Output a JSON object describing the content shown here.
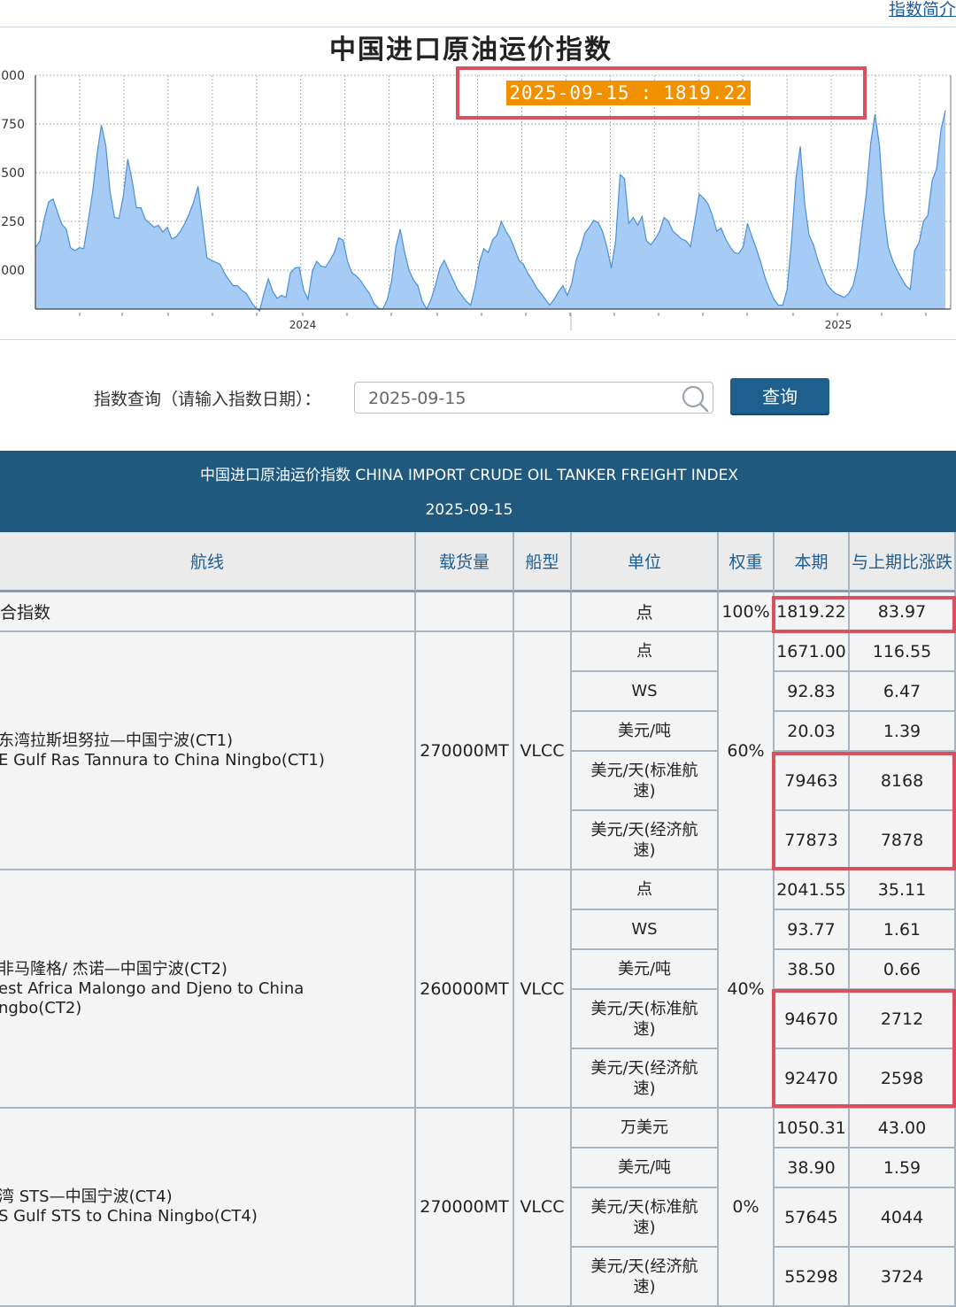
{
  "top_link": "指数简介",
  "chart": {
    "title": "中国进口原油运价指数",
    "tooltip_date": "2025-09-15",
    "tooltip_sep": ":",
    "tooltip_value": "1819.22"
  },
  "chart_data": {
    "type": "area",
    "title": "中国进口原油运价指数",
    "y_tick_labels": [
      "000",
      "750",
      "500",
      "250",
      "000"
    ],
    "x_tick_labels": [
      "2024",
      "2025"
    ],
    "grid": true,
    "fill_color": "#a6cbf5",
    "line_color": "#4a90d9",
    "series": [
      {
        "values": [
          1115,
          1150,
          1260,
          1350,
          1365,
          1300,
          1235,
          1210,
          1115,
          1100,
          1115,
          1110,
          1250,
          1400,
          1590,
          1745,
          1640,
          1400,
          1270,
          1265,
          1380,
          1570,
          1460,
          1320,
          1320,
          1260,
          1240,
          1220,
          1230,
          1195,
          1220,
          1160,
          1170,
          1200,
          1240,
          1290,
          1350,
          1430,
          1250,
          1065,
          1050,
          1040,
          1030,
          985,
          950,
          920,
          920,
          895,
          880,
          840,
          810,
          790,
          880,
          955,
          890,
          855,
          870,
          860,
          985,
          1010,
          1015,
          900,
          850,
          995,
          1045,
          1020,
          1015,
          1050,
          1090,
          1165,
          1155,
          1045,
          985,
          970,
          945,
          910,
          880,
          830,
          805,
          800,
          845,
          940,
          1120,
          1210,
          1090,
          1000,
          950,
          920,
          840,
          800,
          850,
          920,
          1010,
          1050,
          1000,
          950,
          900,
          870,
          840,
          820,
          910,
          1040,
          1110,
          1090,
          1155,
          1180,
          1250,
          1200,
          1165,
          1110,
          1050,
          1030,
          985,
          950,
          910,
          880,
          850,
          820,
          850,
          890,
          920,
          870,
          930,
          1050,
          1110,
          1190,
          1220,
          1255,
          1245,
          1200,
          1120,
          1010,
          1150,
          1490,
          1470,
          1240,
          1270,
          1230,
          1275,
          1150,
          1130,
          1160,
          1200,
          1270,
          1250,
          1200,
          1180,
          1160,
          1150,
          1120,
          1250,
          1390,
          1370,
          1340,
          1280,
          1200,
          1215,
          1160,
          1120,
          1090,
          1085,
          1120,
          1240,
          1170,
          1110,
          1040,
          960,
          900,
          850,
          820,
          820,
          900,
          1150,
          1470,
          1635,
          1340,
          1180,
          1130,
          1050,
          990,
          930,
          900,
          880,
          870,
          860,
          880,
          920,
          1020,
          1210,
          1390,
          1650,
          1800,
          1640,
          1300,
          1120,
          1050,
          1000,
          960,
          920,
          900,
          1100,
          1140,
          1250,
          1280,
          1460,
          1520,
          1720,
          1819
        ]
      }
    ]
  },
  "query": {
    "label": "指数查询（请输入指数日期）：",
    "input_value": "2025-09-15",
    "button": "查询"
  },
  "table": {
    "title": "中国进口原油运价指数 CHINA IMPORT CRUDE OIL TANKER FREIGHT INDEX",
    "date": "2025-09-15",
    "headers": {
      "route": "航线",
      "cargo": "载货量",
      "ship": "船型",
      "unit": "单位",
      "weight": "权重",
      "current": "本期",
      "change": "与上期比涨跌"
    },
    "composite": {
      "name": "合指数",
      "unit": "点",
      "weight": "100%",
      "current": "1819.22",
      "change": "83.97"
    },
    "routes": [
      {
        "name": "东湾拉斯坦努拉—中国宁波(CT1)\nE Gulf Ras Tannura to China Ningbo(CT1)",
        "cargo": "270000MT",
        "ship": "VLCC",
        "weight": "60%",
        "rows": [
          {
            "unit": "点",
            "current": "1671.00",
            "change": "116.55"
          },
          {
            "unit": "WS",
            "current": "92.83",
            "change": "6.47"
          },
          {
            "unit": "美元/吨",
            "current": "20.03",
            "change": "1.39"
          },
          {
            "unit": "美元/天(标准航速)",
            "current": "79463",
            "change": "8168"
          },
          {
            "unit": "美元/天(经济航速)",
            "current": "77873",
            "change": "7878"
          }
        ]
      },
      {
        "name": "非马隆格/ 杰诺—中国宁波(CT2)\nest Africa Malongo and Djeno to China\nngbo(CT2)",
        "cargo": "260000MT",
        "ship": "VLCC",
        "weight": "40%",
        "rows": [
          {
            "unit": "点",
            "current": "2041.55",
            "change": "35.11"
          },
          {
            "unit": "WS",
            "current": "93.77",
            "change": "1.61"
          },
          {
            "unit": "美元/吨",
            "current": "38.50",
            "change": "0.66"
          },
          {
            "unit": "美元/天(标准航速)",
            "current": "94670",
            "change": "2712"
          },
          {
            "unit": "美元/天(经济航速)",
            "current": "92470",
            "change": "2598"
          }
        ]
      },
      {
        "name": "湾 STS—中国宁波(CT4)\nS Gulf STS to China Ningbo(CT4)",
        "cargo": "270000MT",
        "ship": "VLCC",
        "weight": "0%",
        "rows": [
          {
            "unit": "万美元",
            "current": "1050.31",
            "change": "43.00"
          },
          {
            "unit": "美元/吨",
            "current": "38.90",
            "change": "1.59"
          },
          {
            "unit": "美元/天(标准航速)",
            "current": "57645",
            "change": "4044"
          },
          {
            "unit": "美元/天(经济航速)",
            "current": "55298",
            "change": "3724"
          }
        ]
      }
    ]
  }
}
